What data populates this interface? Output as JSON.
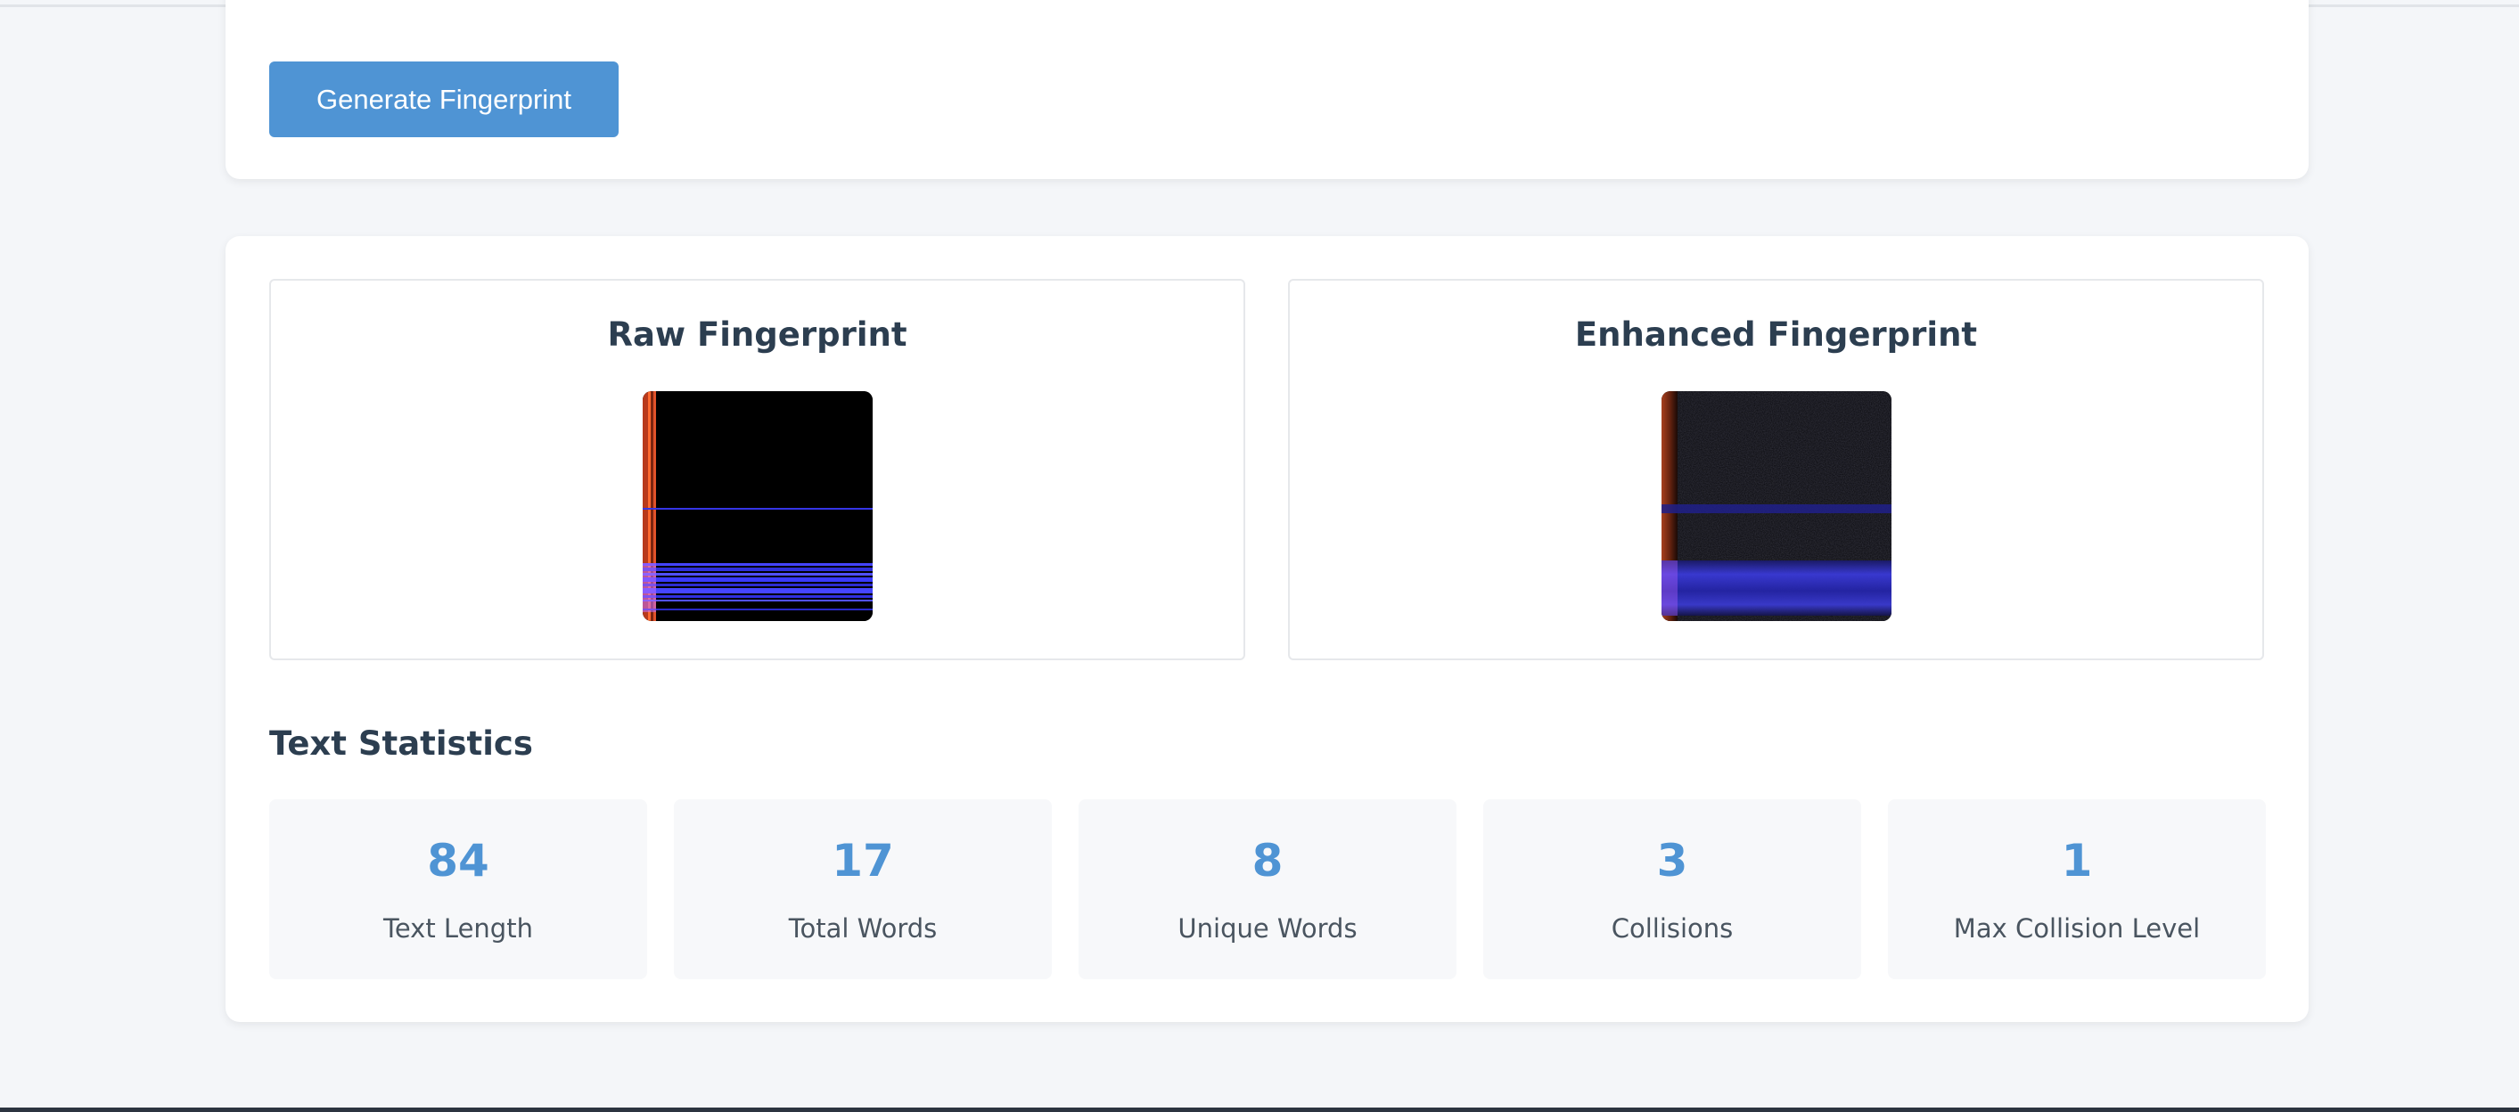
{
  "controls": {
    "generate_label": "Generate Fingerprint"
  },
  "fingerprints": {
    "raw_title": "Raw Fingerprint",
    "enhanced_title": "Enhanced Fingerprint"
  },
  "stats": {
    "heading": "Text Statistics",
    "items": [
      {
        "value": "84",
        "label": "Text Length"
      },
      {
        "value": "17",
        "label": "Total Words"
      },
      {
        "value": "8",
        "label": "Unique Words"
      },
      {
        "value": "3",
        "label": "Collisions"
      },
      {
        "value": "1",
        "label": "Max Collision Level"
      }
    ]
  },
  "colors": {
    "accent": "#4f94d4",
    "heading": "#2c3e50",
    "stripe_orange": "#e0522a",
    "stripe_blue": "#3c3cff"
  }
}
